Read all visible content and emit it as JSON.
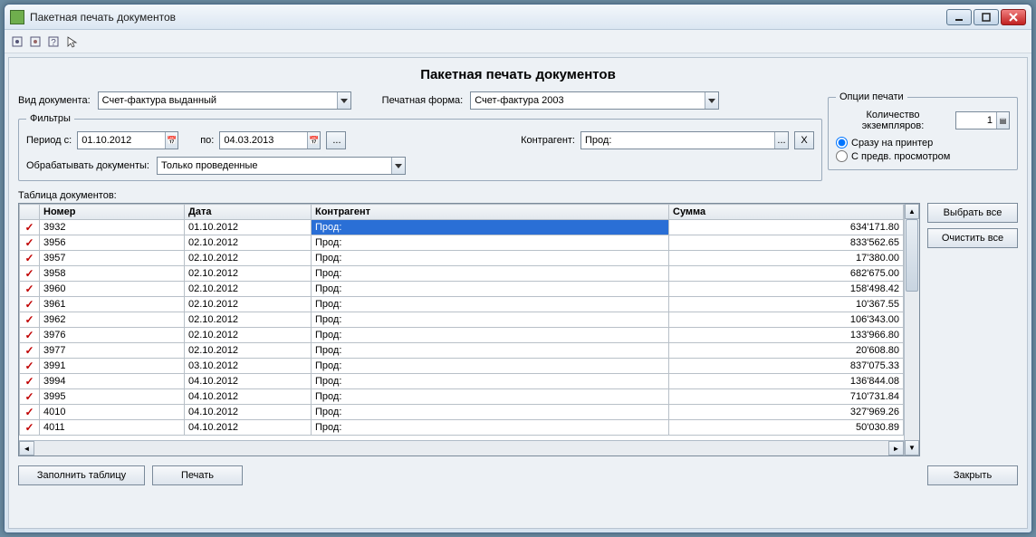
{
  "window": {
    "title": "Пакетная печать документов"
  },
  "page_title": "Пакетная печать документов",
  "labels": {
    "doc_type": "Вид документа:",
    "print_form": "Печатная форма:",
    "filters_legend": "Фильтры",
    "period_from": "Период с:",
    "period_to": "по:",
    "contractor": "Контрагент:",
    "process_docs": "Обрабатывать документы:",
    "print_opts_legend": "Опции печати",
    "copies": "Количество экземпляров:",
    "radio_direct": "Сразу на принтер",
    "radio_preview": "С предв. просмотром",
    "table_label": "Таблица документов:",
    "select_all": "Выбрать все",
    "clear_all": "Очистить все",
    "fill_table": "Заполнить таблицу",
    "print": "Печать",
    "close": "Закрыть",
    "dots": "...",
    "x": "X"
  },
  "values": {
    "doc_type": "Счет-фактура выданный",
    "print_form": "Счет-фактура 2003",
    "period_from": "01.10.2012",
    "period_to": "04.03.2013",
    "contractor": "Прод:",
    "process_docs": "Только проведенные",
    "copies": "1",
    "radio_selected": "direct"
  },
  "columns": {
    "check": "",
    "number": "Номер",
    "date": "Дата",
    "contractor": "Контрагент",
    "sum": "Сумма"
  },
  "rows": [
    {
      "chk": true,
      "no": "3932",
      "date": "01.10.2012",
      "ctr": "Прод:",
      "sum": "634'171.80",
      "selected": true
    },
    {
      "chk": true,
      "no": "3956",
      "date": "02.10.2012",
      "ctr": "Прод:",
      "sum": "833'562.65"
    },
    {
      "chk": true,
      "no": "3957",
      "date": "02.10.2012",
      "ctr": "Прод:",
      "sum": "17'380.00"
    },
    {
      "chk": true,
      "no": "3958",
      "date": "02.10.2012",
      "ctr": "Прод:",
      "sum": "682'675.00"
    },
    {
      "chk": true,
      "no": "3960",
      "date": "02.10.2012",
      "ctr": "Прод:",
      "sum": "158'498.42"
    },
    {
      "chk": true,
      "no": "3961",
      "date": "02.10.2012",
      "ctr": "Прод:",
      "sum": "10'367.55"
    },
    {
      "chk": true,
      "no": "3962",
      "date": "02.10.2012",
      "ctr": "Прод:",
      "sum": "106'343.00"
    },
    {
      "chk": true,
      "no": "3976",
      "date": "02.10.2012",
      "ctr": "Прод:",
      "sum": "133'966.80"
    },
    {
      "chk": true,
      "no": "3977",
      "date": "02.10.2012",
      "ctr": "Прод:",
      "sum": "20'608.80"
    },
    {
      "chk": true,
      "no": "3991",
      "date": "03.10.2012",
      "ctr": "Прод:",
      "sum": "837'075.33"
    },
    {
      "chk": true,
      "no": "3994",
      "date": "04.10.2012",
      "ctr": "Прод:",
      "sum": "136'844.08"
    },
    {
      "chk": true,
      "no": "3995",
      "date": "04.10.2012",
      "ctr": "Прод:",
      "sum": "710'731.84"
    },
    {
      "chk": true,
      "no": "4010",
      "date": "04.10.2012",
      "ctr": "Прод:",
      "sum": "327'969.26"
    },
    {
      "chk": true,
      "no": "4011",
      "date": "04.10.2012",
      "ctr": "Прод:",
      "sum": "50'030.89"
    }
  ]
}
